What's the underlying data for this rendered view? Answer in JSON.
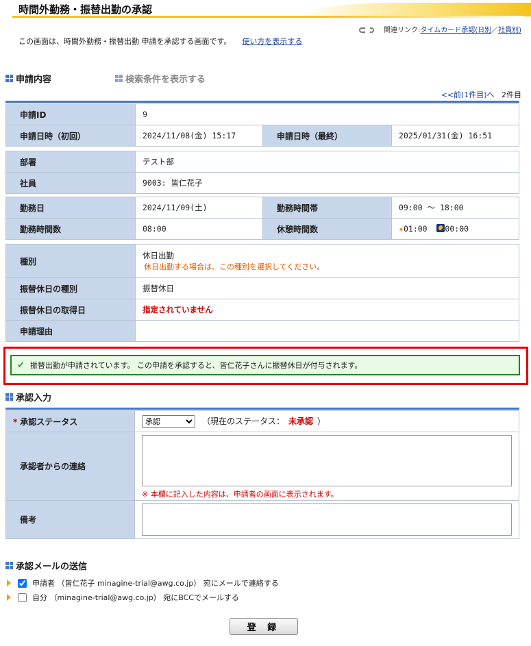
{
  "page": {
    "title": "時間外勤務・振替出勤の承認",
    "related_label": "関連リンク:",
    "related_link_1": "タイムカード承認(日別",
    "related_sep": "／",
    "related_link_2": "社員別)",
    "description": "この画面は、時間外勤務・振替出勤 申請を承認する画面です。",
    "howto_link": "使い方を表示する"
  },
  "section_request": {
    "heading": "申請内容",
    "search_toggle": "検索条件を表示する",
    "pager_prev": "<<前(1件目)へ",
    "pager_count": "2件目"
  },
  "fields": {
    "request_id_label": "申請ID",
    "request_id": "9",
    "applied_first_label": "申請日時（初回）",
    "applied_first": "2024/11/08(金) 15:17",
    "applied_last_label": "申請日時（最終）",
    "applied_last": "2025/01/31(金) 16:51",
    "dept_label": "部署",
    "dept": "テスト部",
    "employee_label": "社員",
    "employee": "9003: 皆仁花子",
    "work_date_label": "勤務日",
    "work_date": "2024/11/09(土)",
    "work_hours_label": "勤務時間帯",
    "work_hours": "09:00 ～ 18:00",
    "work_duration_label": "勤務時間数",
    "work_duration": "08:00",
    "break_label": "休憩時間数",
    "break_day": "01:00",
    "break_night": "00:00",
    "type_label": "種別",
    "type": "休日出勤",
    "type_note": "休日出勤する場合は、この種別を選択してください。",
    "sub_type_label": "振替休日の種別",
    "sub_type": "振替休日",
    "sub_date_label": "振替休日の取得日",
    "sub_date": "指定されていません",
    "reason_label": "申請理由",
    "reason": ""
  },
  "alert": {
    "text": "振替出勤が申請されています。 この申請を承認すると、皆仁花子さんに振替休日が付与されます。"
  },
  "section_approval": {
    "heading": "承認入力",
    "status_label": "承認ステータス",
    "status_selected": "承認",
    "current_status_prefix": "（現在のステータス：",
    "current_status": "未承認",
    "current_status_suffix": "）",
    "message_label": "承認者からの連絡",
    "message_value": "",
    "message_note": "※ 本欄に記入した内容は、申請者の画面に表示されます。",
    "remarks_label": "備考",
    "remarks_value": ""
  },
  "section_mail": {
    "heading": "承認メールの送信",
    "option_1": "申請者 （皆仁花子 minagine-trial@awg.co.jp） 宛にメールで連絡する",
    "option_1_checked": true,
    "option_2": "自分 （minagine-trial@awg.co.jp） 宛にBCCでメールする",
    "option_2_checked": false
  },
  "buttons": {
    "register": "登 録"
  },
  "colors": {
    "label_bg": "#c7d6ea",
    "accent_blue": "#3f78c8",
    "alert_border": "#e80000",
    "success_border": "#1b8b1b",
    "error_red": "#d40000",
    "note_orange": "#e05a00"
  }
}
